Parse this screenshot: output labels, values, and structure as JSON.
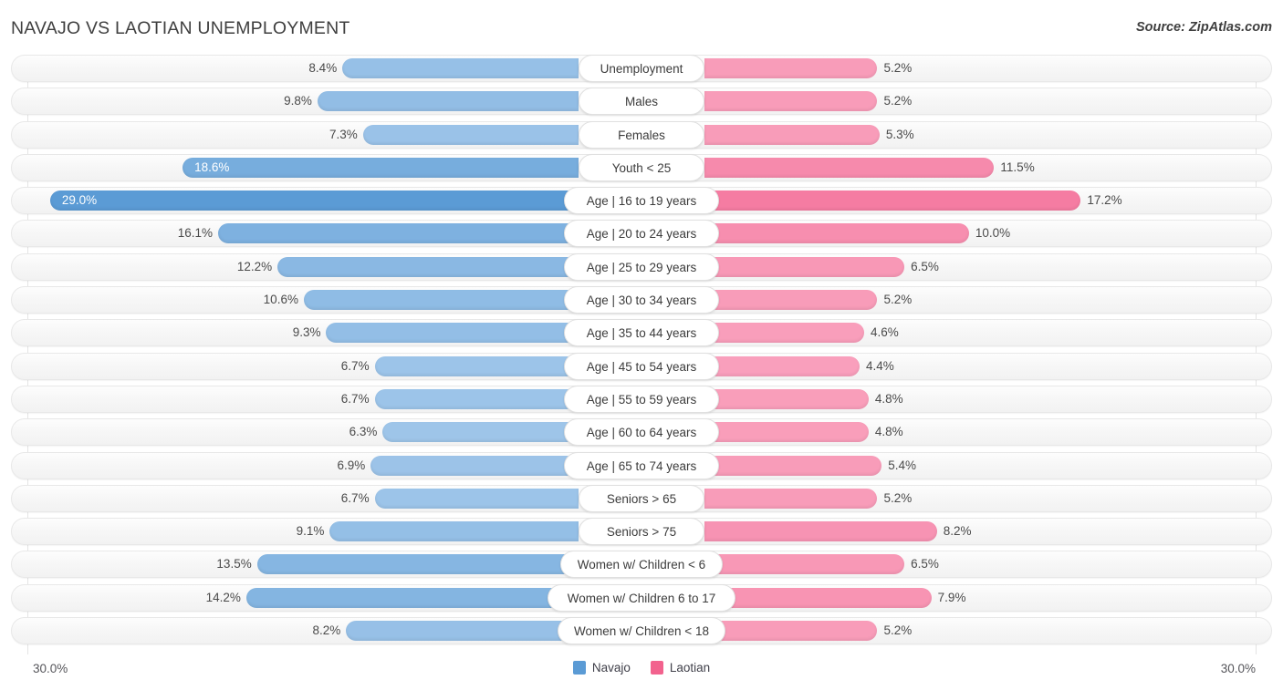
{
  "header": {
    "title": "NAVAJO VS LAOTIAN UNEMPLOYMENT",
    "source": "Source: ZipAtlas.com"
  },
  "legend": {
    "left": {
      "label": "Navajo",
      "color": "#5B9BD5"
    },
    "right": {
      "label": "Laotian",
      "color": "#F2628E"
    }
  },
  "axis": {
    "left_max_label": "30.0%",
    "right_max_label": "30.0%",
    "max": 30.0
  },
  "chart_data": {
    "type": "bar",
    "orientation": "horizontal-diverging",
    "title": "NAVAJO VS LAOTIAN UNEMPLOYMENT",
    "xlabel": "",
    "ylabel": "",
    "xlim": [
      30.0,
      30.0
    ],
    "grid": true,
    "legend_position": "bottom-center",
    "categories": [
      "Unemployment",
      "Males",
      "Females",
      "Youth < 25",
      "Age | 16 to 19 years",
      "Age | 20 to 24 years",
      "Age | 25 to 29 years",
      "Age | 30 to 34 years",
      "Age | 35 to 44 years",
      "Age | 45 to 54 years",
      "Age | 55 to 59 years",
      "Age | 60 to 64 years",
      "Age | 65 to 74 years",
      "Seniors > 65",
      "Seniors > 75",
      "Women w/ Children < 6",
      "Women w/ Children 6 to 17",
      "Women w/ Children < 18"
    ],
    "series": [
      {
        "name": "Navajo",
        "color": "#5B9BD5",
        "values": [
          8.4,
          9.8,
          7.3,
          18.6,
          29.0,
          16.1,
          12.2,
          10.6,
          9.3,
          6.7,
          6.7,
          6.3,
          6.9,
          6.7,
          9.1,
          13.5,
          14.2,
          8.2
        ],
        "labels": [
          "8.4%",
          "9.8%",
          "7.3%",
          "18.6%",
          "29.0%",
          "16.1%",
          "12.2%",
          "10.6%",
          "9.3%",
          "6.7%",
          "6.7%",
          "6.3%",
          "6.9%",
          "6.7%",
          "9.1%",
          "13.5%",
          "14.2%",
          "8.2%"
        ]
      },
      {
        "name": "Laotian",
        "color": "#F2628E",
        "values": [
          5.2,
          5.2,
          5.3,
          11.5,
          17.2,
          10.0,
          6.5,
          5.2,
          4.6,
          4.4,
          4.8,
          4.8,
          5.4,
          5.2,
          8.2,
          6.5,
          7.9,
          5.2
        ],
        "labels": [
          "5.2%",
          "5.2%",
          "5.3%",
          "11.5%",
          "17.2%",
          "10.0%",
          "6.5%",
          "5.2%",
          "4.6%",
          "4.4%",
          "4.8%",
          "4.8%",
          "5.4%",
          "5.2%",
          "8.2%",
          "6.5%",
          "7.9%",
          "5.2%"
        ]
      }
    ]
  }
}
